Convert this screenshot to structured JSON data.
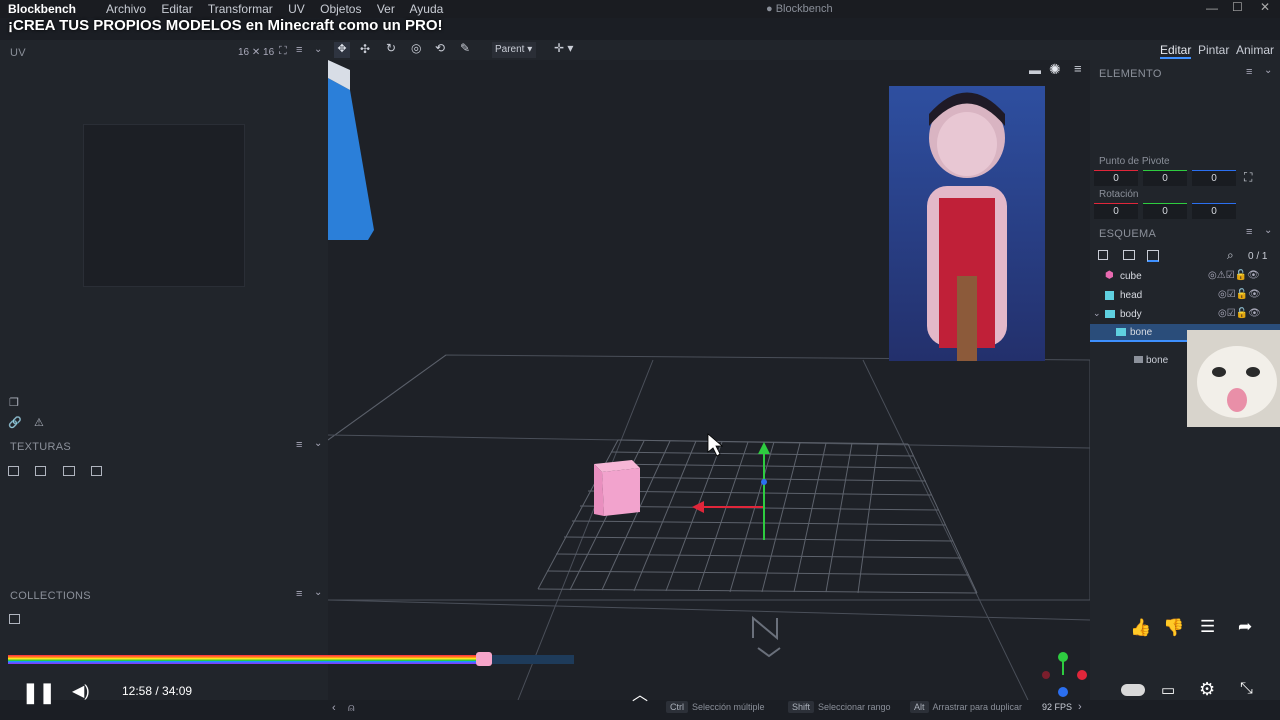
{
  "app": {
    "name": "Blockbench",
    "window_title": "● Blockbench"
  },
  "menu": [
    "Archivo",
    "Editar",
    "Transformar",
    "UV",
    "Objetos",
    "Ver",
    "Ayuda"
  ],
  "video_title": "¡CREA TUS PROPIOS MODELOS en Minecraft como un PRO!",
  "uv_panel": {
    "label": "UV",
    "grid_size": "16 ✕ 16"
  },
  "toolbar": {
    "parent_select": "Parent"
  },
  "mode_tabs": [
    "Editar",
    "Pintar",
    "Animar"
  ],
  "textures_panel": {
    "label": "TEXTURAS"
  },
  "collections_panel": {
    "label": "COLLECTIONS"
  },
  "element_panel": {
    "label": "ELEMENTO",
    "pivot_label": "Punto de Pivote",
    "pivot": [
      "0",
      "0",
      "0"
    ],
    "rotation_label": "Rotación",
    "rotation": [
      "0",
      "0",
      "0"
    ]
  },
  "outliner": {
    "label": "ESQUEMA",
    "count": "0 / 1",
    "items": [
      {
        "name": "cube",
        "type": "cube"
      },
      {
        "name": "head",
        "type": "mesh"
      },
      {
        "name": "body",
        "type": "group"
      },
      {
        "name": "bone",
        "type": "folder"
      }
    ],
    "drag_ghost": "bone"
  },
  "player": {
    "time": "12:58 / 34:09",
    "progress": 0.38
  },
  "statusbar": {
    "hints": [
      {
        "key": "Ctrl",
        "text": "Selección múltiple"
      },
      {
        "key": "Shift",
        "text": "Seleccionar rango"
      },
      {
        "key": "Alt",
        "text": "Arrastrar para duplicar"
      }
    ],
    "fps": "92 FPS"
  },
  "colors": {
    "accent": "#3e90ff",
    "bg": "#1b1e24",
    "panel": "#21252b"
  }
}
